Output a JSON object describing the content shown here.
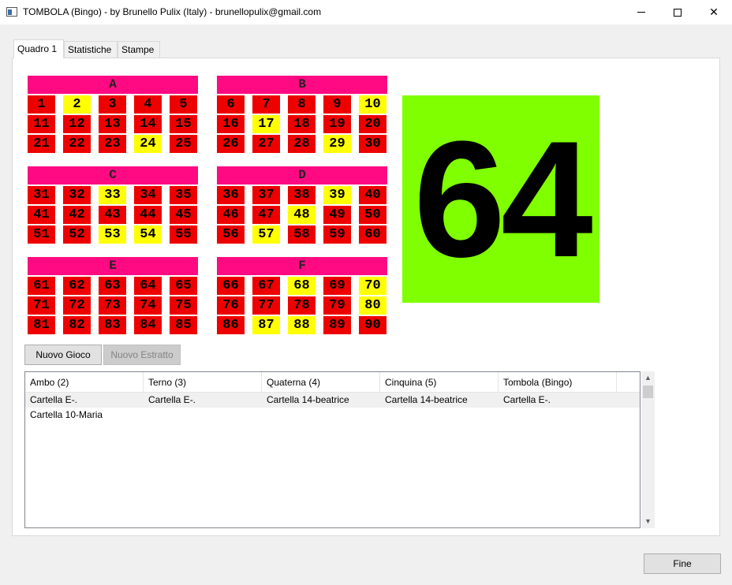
{
  "window": {
    "title": "TOMBOLA (Bingo) - by Brunello Pulix (Italy) - brunellopulix@gmail.com",
    "min_icon": "minimize-icon",
    "max_icon": "maximize-icon",
    "close_label": "✕"
  },
  "tabs": [
    {
      "label": "Quadro 1",
      "active": true
    },
    {
      "label": "Statistiche",
      "active": false
    },
    {
      "label": "Stampe",
      "active": false
    }
  ],
  "boards": [
    {
      "label": "A",
      "rows": [
        [
          1,
          2,
          3,
          4,
          5
        ],
        [
          11,
          12,
          13,
          14,
          15
        ],
        [
          21,
          22,
          23,
          24,
          25
        ]
      ]
    },
    {
      "label": "B",
      "rows": [
        [
          6,
          7,
          8,
          9,
          10
        ],
        [
          16,
          17,
          18,
          19,
          20
        ],
        [
          26,
          27,
          28,
          29,
          30
        ]
      ]
    },
    {
      "label": "C",
      "rows": [
        [
          31,
          32,
          33,
          34,
          35
        ],
        [
          41,
          42,
          43,
          44,
          45
        ],
        [
          51,
          52,
          53,
          54,
          55
        ]
      ]
    },
    {
      "label": "D",
      "rows": [
        [
          36,
          37,
          38,
          39,
          40
        ],
        [
          46,
          47,
          48,
          49,
          50
        ],
        [
          56,
          57,
          58,
          59,
          60
        ]
      ]
    },
    {
      "label": "E",
      "rows": [
        [
          61,
          62,
          63,
          64,
          65
        ],
        [
          71,
          72,
          73,
          74,
          75
        ],
        [
          81,
          82,
          83,
          84,
          85
        ]
      ]
    },
    {
      "label": "F",
      "rows": [
        [
          66,
          67,
          68,
          69,
          70
        ],
        [
          76,
          77,
          78,
          79,
          80
        ],
        [
          86,
          87,
          88,
          89,
          90
        ]
      ]
    }
  ],
  "drawn_numbers": [
    2,
    10,
    17,
    24,
    29,
    33,
    39,
    48,
    53,
    54,
    57,
    68,
    70,
    80,
    87,
    88
  ],
  "colors": {
    "undrawn": "#ee0000",
    "drawn": "#ffff00",
    "header": "#ff0a82",
    "current": "#80ff00"
  },
  "current_number": "64",
  "buttons": {
    "new_game": "Nuovo Gioco",
    "new_draw": "Nuovo Estratto",
    "exit": "Fine"
  },
  "results": {
    "columns": [
      "Ambo (2)",
      "Terno (3)",
      "Quaterna (4)",
      "Cinquina (5)",
      "Tombola (Bingo)"
    ],
    "rows": [
      [
        "Cartella  E-.",
        "Cartella  E-.",
        "Cartella 14-beatrice",
        "Cartella 14-beatrice",
        "Cartella  E-."
      ],
      [
        "Cartella 10-Maria",
        "",
        "",
        "",
        ""
      ]
    ]
  },
  "scrollbar": {
    "up_icon": "▲",
    "down_icon": "▼"
  }
}
